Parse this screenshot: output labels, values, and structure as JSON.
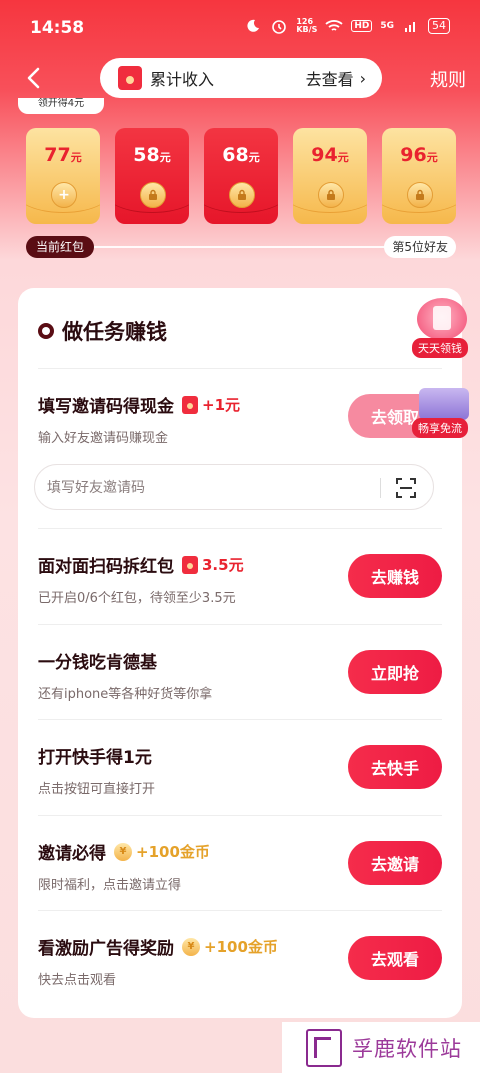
{
  "status_bar": {
    "time": "14:58",
    "net_speed": "126\nKB/S",
    "hd": "HD",
    "signal": "5G",
    "battery": "54"
  },
  "header": {
    "income_label": "累计收入",
    "view_link": "去查看",
    "rules": "规则"
  },
  "top_strip": "领开得4元",
  "packets": [
    {
      "amount": "77",
      "unit": "元",
      "style": "gold",
      "state": "open"
    },
    {
      "amount": "58",
      "unit": "元",
      "style": "red",
      "state": "locked"
    },
    {
      "amount": "68",
      "unit": "元",
      "style": "red",
      "state": "locked"
    },
    {
      "amount": "94",
      "unit": "元",
      "style": "gold",
      "state": "locked"
    },
    {
      "amount": "96",
      "unit": "元",
      "style": "gold",
      "state": "locked"
    }
  ],
  "progress": {
    "current": "当前红包",
    "fifth": "第5位好友"
  },
  "section_title": "做任务赚钱",
  "float_widgets": {
    "daily": "天天领钱",
    "free_flow": "畅享免流"
  },
  "tasks": [
    {
      "title": "填写邀请码得现金",
      "bonus": "+1元",
      "bonus_type": "cash",
      "subtitle": "输入好友邀请码赚现金",
      "button": "去领取"
    },
    {
      "title": "面对面扫码拆红包",
      "bonus": "3.5元",
      "bonus_type": "cash",
      "subtitle": "已开启0/6个红包，待领至少3.5元",
      "button": "去赚钱"
    },
    {
      "title": "一分钱吃肯德基",
      "bonus": "",
      "bonus_type": "none",
      "subtitle": "还有iphone等各种好货等你拿",
      "button": "立即抢"
    },
    {
      "title": "打开快手得1元",
      "bonus": "",
      "bonus_type": "none",
      "subtitle": "点击按钮可直接打开",
      "button": "去快手"
    },
    {
      "title": "邀请必得",
      "bonus": "+100金币",
      "bonus_type": "coin",
      "subtitle": "限时福利，点击邀请立得",
      "button": "去邀请"
    },
    {
      "title": "看激励广告得奖励",
      "bonus": "+100金币",
      "bonus_type": "coin",
      "subtitle": "快去点击观看",
      "button": "去观看"
    }
  ],
  "invite_input": {
    "placeholder": "填写好友邀请码",
    "value": ""
  },
  "watermark": "孚鹿软件站",
  "colors": {
    "primary": "#f0233f",
    "header_bg": "#f6363f",
    "gold": "#e5a22a",
    "dark": "#2b0c10"
  }
}
